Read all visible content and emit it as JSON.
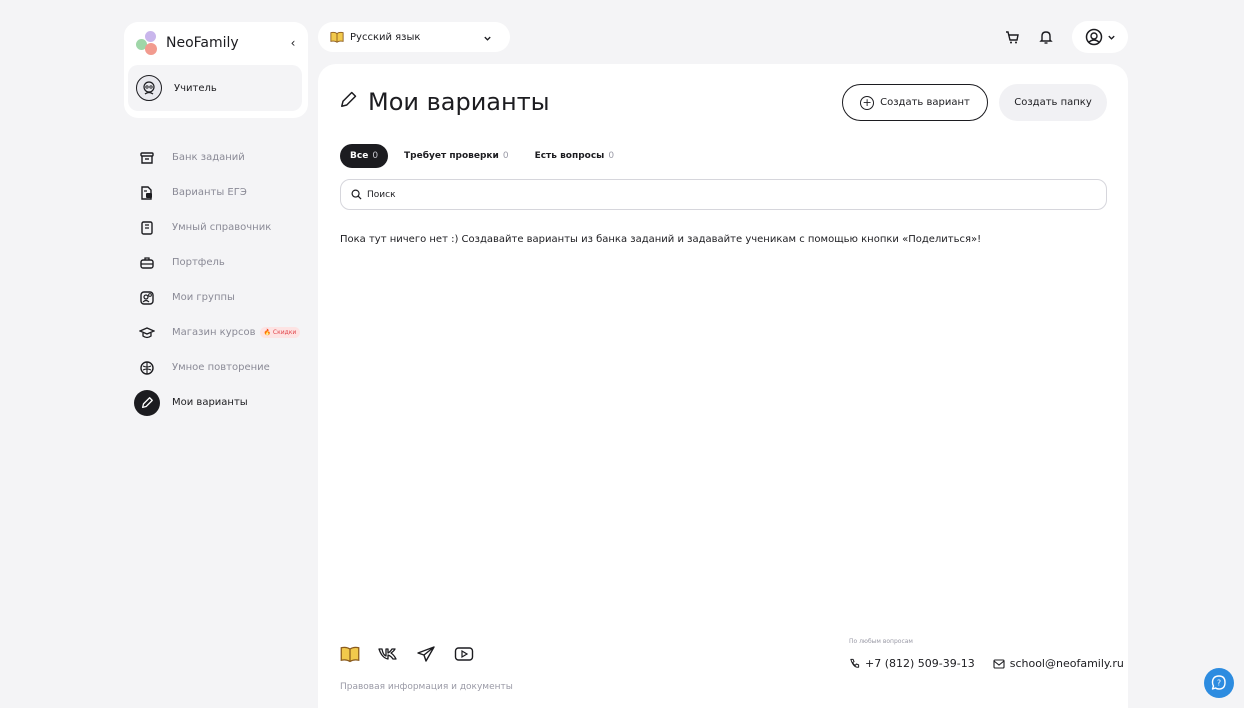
{
  "brand": {
    "name": "NeoFamily",
    "collapse_glyph": "‹"
  },
  "role": {
    "label": "Учитель"
  },
  "sidebar": {
    "items": [
      {
        "label": "Банк заданий",
        "icon": "archive-icon"
      },
      {
        "label": "Варианты ЕГЭ",
        "icon": "document-icon"
      },
      {
        "label": "Умный справочник",
        "icon": "book-icon"
      },
      {
        "label": "Портфель",
        "icon": "briefcase-icon"
      },
      {
        "label": "Мои группы",
        "icon": "group-icon"
      },
      {
        "label": "Магазин курсов",
        "icon": "graduation-cap-icon",
        "badge": "🔥 Скидки"
      },
      {
        "label": "Умное повторение",
        "icon": "brain-icon"
      },
      {
        "label": "Мои варианты",
        "icon": "pencil-icon",
        "active": true
      }
    ]
  },
  "subject": {
    "label": "Русский язык",
    "icon": "book-emoji-icon"
  },
  "header": {
    "icons": [
      "cart-icon",
      "bell-icon",
      "user-icon"
    ]
  },
  "main": {
    "title": "Мои варианты",
    "create_variant": "Создать вариант",
    "create_folder": "Создать папку",
    "tabs": [
      {
        "label": "Все",
        "count": "0",
        "active": true
      },
      {
        "label": "Требует проверки",
        "count": "0"
      },
      {
        "label": "Есть вопросы",
        "count": "0"
      }
    ],
    "search": {
      "placeholder": "Поиск",
      "value": ""
    },
    "empty_text": "Пока тут ничего нет :) Создавайте варианты из банка заданий и задавайте ученикам с помощью кнопки «Поделиться»!"
  },
  "footer": {
    "social_icons": [
      "book-emoji-icon",
      "vk-icon",
      "telegram-icon",
      "youtube-icon"
    ],
    "legal": "Правовая информация и документы",
    "contact_caption": "По любым вопросам",
    "phone": "+7 (812) 509-39-13",
    "email": "school@neofamily.ru"
  },
  "colors": {
    "accent": "#1c1c20",
    "help_button": "#2d8ce0",
    "sale": "#e0454b",
    "background": "#f4f4f6"
  }
}
